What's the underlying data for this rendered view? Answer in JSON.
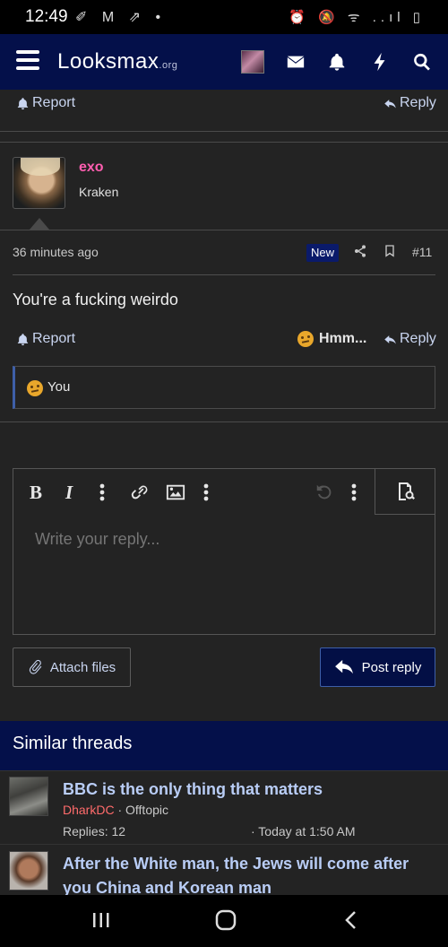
{
  "status_bar": {
    "time": "12:49",
    "left_icons": "✐ M ⇗ •",
    "right_icons": "⏰ 🔕 ᯤ ..ıl ▯"
  },
  "nav": {
    "logo": "Looksmax",
    "logo_tld": ".org"
  },
  "prev_post": {
    "report_label": "Report",
    "reply_label": "Reply"
  },
  "post": {
    "username": "exo",
    "user_title": "Kraken",
    "time": "36 minutes ago",
    "badge": "New",
    "number": "#11",
    "body": "You're a fucking weirdo",
    "report_label": "Report",
    "reaction_label": "Hmm...",
    "reply_label": "Reply",
    "reactions_text": "You"
  },
  "editor": {
    "placeholder": "Write your reply..."
  },
  "buttons": {
    "attach": "Attach files",
    "post": "Post reply"
  },
  "similar": {
    "heading": "Similar threads",
    "threads": [
      {
        "title": "BBC is the only thing that matters",
        "author": "DharkDC",
        "forum": " · Offtopic",
        "replies": "Replies: 12",
        "date": "· Today at 1:50 AM"
      },
      {
        "title": "After the White man, the Jews will come after you China and Korean man"
      }
    ]
  },
  "colors": {
    "nav_bg": "#04104a",
    "username": "#ff5eb0",
    "link": "#c9d5f0",
    "author": "#ff6b6b"
  }
}
